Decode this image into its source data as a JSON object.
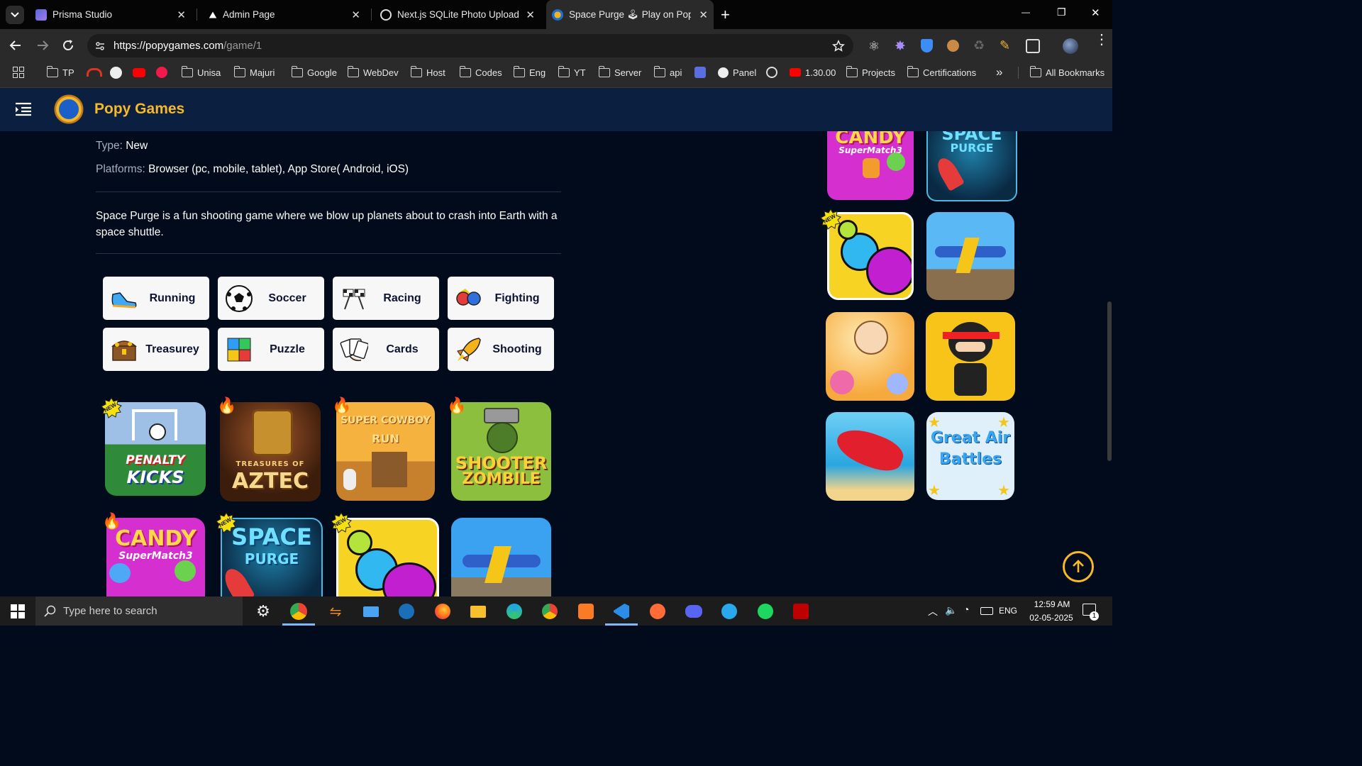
{
  "browser": {
    "tabs": [
      {
        "title": "Prisma Studio",
        "active": false
      },
      {
        "title": "Admin Page",
        "active": false
      },
      {
        "title": "Next.js SQLite Photo Upload",
        "active": false
      },
      {
        "title": "Space Purge 🕹 Play on Popyg",
        "active": true
      }
    ],
    "new_tab": "+",
    "url_host": "https://popygames.com",
    "url_path": "/game/1",
    "window_controls": {
      "minimize": "—",
      "restore": "❐",
      "close": "✕"
    },
    "bookmarks": [
      {
        "label": "TP",
        "icon": "folder-icon"
      },
      {
        "label": "",
        "icon": "speedometer-icon"
      },
      {
        "label": "",
        "icon": "github-icon"
      },
      {
        "label": "",
        "icon": "youtube-icon"
      },
      {
        "label": "",
        "icon": "play-circle-icon"
      },
      {
        "label": "Unisa",
        "icon": "folder-icon"
      },
      {
        "label": "Majuri",
        "icon": "folder-icon"
      },
      {
        "label": "Google",
        "icon": "folder-icon"
      },
      {
        "label": "WebDev",
        "icon": "folder-icon"
      },
      {
        "label": "Host",
        "icon": "folder-icon"
      },
      {
        "label": "Codes",
        "icon": "folder-icon"
      },
      {
        "label": "Eng",
        "icon": "folder-icon"
      },
      {
        "label": "YT",
        "icon": "folder-icon"
      },
      {
        "label": "Server",
        "icon": "folder-icon"
      },
      {
        "label": "api",
        "icon": "folder-icon"
      },
      {
        "label": "",
        "icon": "tools-icon"
      },
      {
        "label": "Panel",
        "icon": "globe-icon"
      },
      {
        "label": "",
        "icon": "openai-icon"
      },
      {
        "label": "1.30.00",
        "icon": "youtube-icon"
      },
      {
        "label": "Projects",
        "icon": "folder-icon"
      },
      {
        "label": "Certifications",
        "icon": "folder-icon"
      }
    ],
    "more_bookmarks": "»",
    "all_bookmarks": "All Bookmarks"
  },
  "site": {
    "name": "Popy Games",
    "game": {
      "type_label": "Type:",
      "type_value": "New",
      "platforms_label": "Platforms:",
      "platforms_value": "Browser (pc, mobile, tablet), App Store( Android, iOS)",
      "description": "Space Purge is a fun shooting game where we blow up planets about to crash into Earth with a space shuttle."
    },
    "categories": [
      "Running",
      "Soccer",
      "Racing",
      "Fighting",
      "Treasurey",
      "Puzzle",
      "Cards",
      "Shooting"
    ],
    "games_grid": [
      {
        "title_line1": "PENALTY",
        "title_line2": "KICKS",
        "badge": "new"
      },
      {
        "title_line1": "TREASURES OF",
        "title_line2": "AZTEC",
        "badge": "hot"
      },
      {
        "title_line1": "SUPER COWBOY",
        "title_line2": "RUN",
        "badge": "hot"
      },
      {
        "title_line1": "SHOOTER",
        "title_line2": "ZOMBILE",
        "badge": "hot"
      },
      {
        "title_line1": "CANDY",
        "title_line2": "SuperMatch3",
        "badge": "hot"
      },
      {
        "title_line1": "SPACE",
        "title_line2": "PURGE",
        "badge": "new"
      },
      {
        "title_line1": "",
        "title_line2": "",
        "badge": "new"
      },
      {
        "title_line1": "",
        "title_line2": "",
        "badge": ""
      }
    ],
    "sidebar_games": [
      {
        "title_line1": "CANDY",
        "title_line2": "SuperMatch3"
      },
      {
        "title_line1": "SPACE",
        "title_line2": "PURGE"
      },
      {
        "title_line1": "",
        "title_line2": "",
        "badge": "new"
      },
      {
        "title_line1": "",
        "title_line2": ""
      },
      {
        "title_line1": "",
        "title_line2": ""
      },
      {
        "title_line1": "",
        "title_line2": ""
      },
      {
        "title_line1": "",
        "title_line2": ""
      },
      {
        "title_line1": "Great Air",
        "title_line2": "Battles"
      }
    ],
    "new_badge": "NEW"
  },
  "taskbar": {
    "search_placeholder": "Type here to search",
    "lang": "ENG",
    "time": "12:59 AM",
    "date": "02-05-2025",
    "notification_count": "1"
  }
}
